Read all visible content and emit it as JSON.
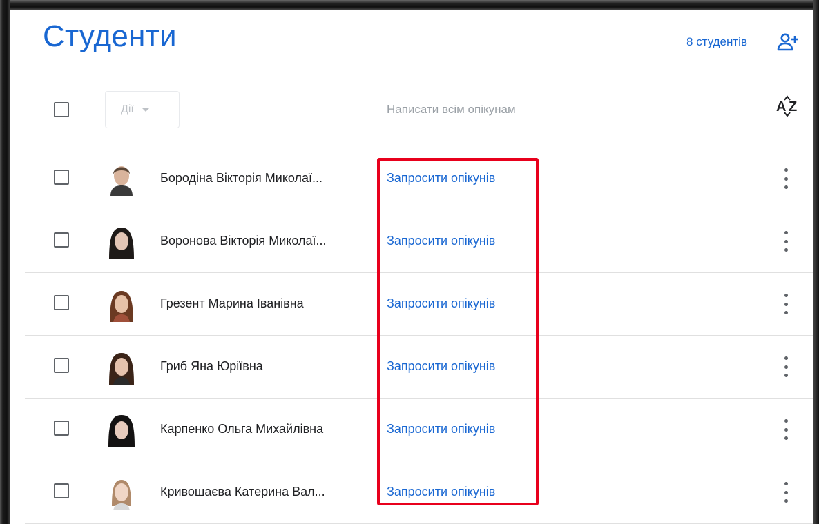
{
  "header": {
    "title": "Студенти",
    "student_count": "8 студентів",
    "add_icon": "person-add-icon"
  },
  "toolbar": {
    "actions_label": "Дії",
    "email_all_guardians": "Написати всім опікунам",
    "sort_icon": "sort-az-icon"
  },
  "students": [
    {
      "name": "Бородіна Вікторія Миколаї...",
      "invite": "Запросити опікунів"
    },
    {
      "name": "Воронова Вікторія Миколаї...",
      "invite": "Запросити опікунів"
    },
    {
      "name": "Грезент Марина Іванівна",
      "invite": "Запросити опікунів"
    },
    {
      "name": "Гриб Яна Юріївна",
      "invite": "Запросити опікунів"
    },
    {
      "name": "Карпенко Ольга Михайлівна",
      "invite": "Запросити опікунів"
    },
    {
      "name": "Кривошаєва Катерина Вал...",
      "invite": "Запросити опікунів"
    }
  ],
  "colors": {
    "accent": "#1967d2",
    "highlight": "#e8001c",
    "text": "#202124",
    "muted": "#9aa0a6"
  }
}
